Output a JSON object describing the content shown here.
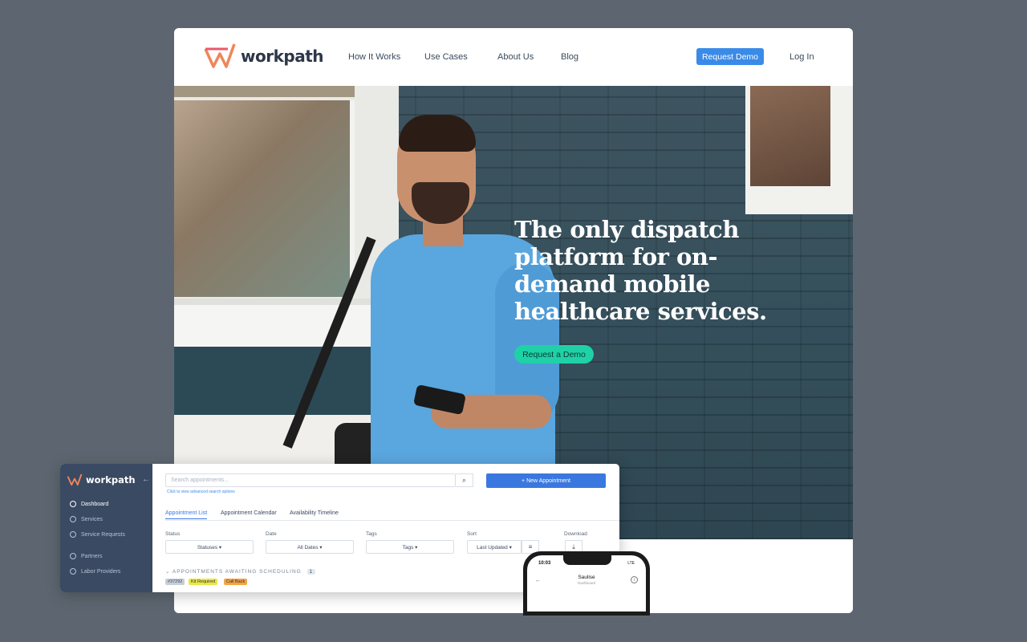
{
  "brand": {
    "name": "workpath",
    "accent": "#3a8be8",
    "logo_colors": [
      "#f0855a",
      "#e85a6a"
    ]
  },
  "nav": {
    "items": [
      {
        "label": "How It Works"
      },
      {
        "label": "Use Cases"
      },
      {
        "label": "About Us"
      },
      {
        "label": "Blog"
      }
    ],
    "request_demo": "Request Demo",
    "login": "Log In"
  },
  "hero": {
    "headline": "The only dispatch platform for on-demand mobile healthcare services.",
    "cta": "Request a Demo",
    "cta_color": "#1fd1a6"
  },
  "dashboard": {
    "logo": "workpath",
    "sidebar": [
      {
        "label": "Dashboard",
        "icon": "dashboard-icon",
        "active": true
      },
      {
        "label": "Services",
        "icon": "services-icon"
      },
      {
        "label": "Service Requests",
        "icon": "requests-icon"
      },
      {
        "label": "Partners",
        "icon": "partners-icon"
      },
      {
        "label": "Labor Providers",
        "icon": "providers-icon"
      }
    ],
    "search_placeholder": "Search appointments...",
    "advanced_link": "Click to view advanced search options",
    "new_appointment": "+ New Appointment",
    "tabs": [
      "Appointment List",
      "Appointment Calendar",
      "Availability Timeline"
    ],
    "filters": {
      "status_label": "Status",
      "status_value": "Statuses ▾",
      "date_label": "Date",
      "date_value": "All Dates ▾",
      "tags_label": "Tags",
      "tags_value": "Tags ▾",
      "sort_label": "Sort",
      "sort_value": "Last Updated ▾",
      "download_label": "Download"
    },
    "section_title": "APPOINTMENTS AWAITING SCHEDULING",
    "section_count": "1",
    "row_tags": [
      {
        "text": "#37292",
        "color": "#c9ced6"
      },
      {
        "text": "Kit Required",
        "color": "#e8e84a"
      },
      {
        "text": "Call Back",
        "color": "#f5a442"
      }
    ]
  },
  "phone": {
    "time": "10:03",
    "status": "LTE",
    "title": "Saulise",
    "subtitle": "Dashboard"
  }
}
